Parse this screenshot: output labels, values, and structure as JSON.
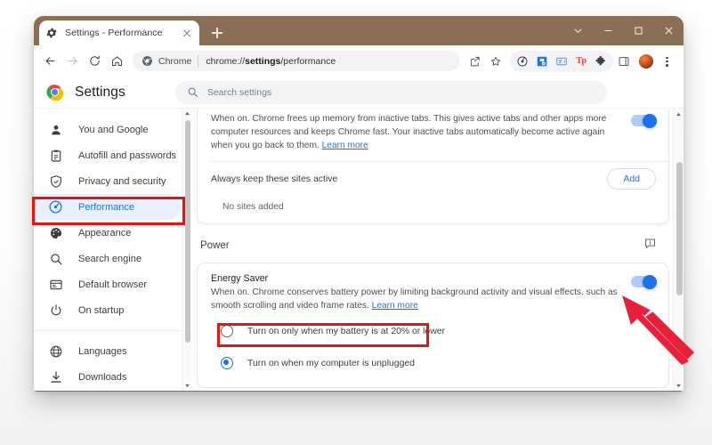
{
  "window": {
    "frame_color": "#8a6f54",
    "controls": [
      {
        "name": "tab-search-chevron",
        "icon": "chevron-down-icon"
      },
      {
        "name": "minimize",
        "icon": "minimize-icon"
      },
      {
        "name": "maximize",
        "icon": "maximize-icon"
      },
      {
        "name": "close",
        "icon": "close-icon"
      }
    ]
  },
  "tab": {
    "title": "Settings - Performance",
    "favicon": "gear-icon",
    "close_icon": "close-icon",
    "new_tab_icon": "plus-icon"
  },
  "toolbar": {
    "back_icon": "arrow-left-icon",
    "forward_icon": "arrow-right-icon",
    "reload_icon": "reload-icon",
    "home_icon": "home-icon",
    "omnibox": {
      "chip_icon": "chrome-circle-icon",
      "chip_label": "Chrome",
      "url_prefix": "chrome://",
      "url_bold": "settings",
      "url_suffix": "/performance"
    },
    "share_icon": "share-icon",
    "bookmark_icon": "star-icon",
    "extensions": [
      {
        "name": "extension-chrome-loop",
        "label": ""
      },
      {
        "name": "extension-blue-save",
        "label": ""
      },
      {
        "name": "extension-reader",
        "label": ""
      },
      {
        "name": "extension-tp",
        "label": "Tp",
        "color": "#ea4335"
      },
      {
        "name": "extensions-puzzle",
        "label": ""
      }
    ],
    "side_panel_icon": "side-panel-icon",
    "avatar": "profile-avatar",
    "menu_icon": "kebab-menu-icon"
  },
  "settings_header": {
    "logo": "chrome-logo",
    "title": "Settings",
    "search": {
      "icon": "search-icon",
      "placeholder": "Search settings",
      "value": ""
    }
  },
  "sidebar": {
    "items": [
      {
        "label": "You and Google",
        "icon": "person-icon",
        "active": false
      },
      {
        "label": "Autofill and passwords",
        "icon": "clipboard-icon",
        "active": false
      },
      {
        "label": "Privacy and security",
        "icon": "shield-icon",
        "active": false
      },
      {
        "label": "Performance",
        "icon": "speedometer-icon",
        "active": true
      },
      {
        "label": "Appearance",
        "icon": "palette-icon",
        "active": false
      },
      {
        "label": "Search engine",
        "icon": "search-icon",
        "active": false
      },
      {
        "label": "Default browser",
        "icon": "browser-window-icon",
        "active": false
      },
      {
        "label": "On startup",
        "icon": "power-icon",
        "active": false
      }
    ],
    "items_after_divider": [
      {
        "label": "Languages",
        "icon": "globe-icon",
        "active": false
      },
      {
        "label": "Downloads",
        "icon": "download-icon",
        "active": false
      }
    ],
    "active_color": "#1a73e8",
    "active_bg": "#e8f0fe"
  },
  "main": {
    "memory_saver": {
      "description": "When on. Chrome frees up memory from inactive tabs. This gives active tabs and other apps more computer resources and keeps Chrome fast. Your inactive tabs automatically become active again when you go back to them.",
      "learn_more": "Learn more",
      "toggle_on": true,
      "sites_label": "Always keep these sites active",
      "add_button": "Add",
      "no_sites": "No sites added"
    },
    "power": {
      "section_title": "Power",
      "feedback_icon": "feedback-icon",
      "energy_saver": {
        "name": "Energy Saver",
        "description": "When on. Chrome conserves battery power by limiting background activity and visual effects. such as smooth scrolling and video frame rates.",
        "learn_more": "Learn more",
        "toggle_on": true,
        "options": [
          {
            "label": "Turn on only when my battery is at 20% or lower",
            "selected": false
          },
          {
            "label": "Turn on when my computer is unplugged",
            "selected": true
          }
        ]
      }
    },
    "scrollbar": {
      "up_icon": "caret-up-icon",
      "down_icon": "caret-down-icon"
    }
  },
  "annotations": {
    "highlight_color": "#ee1111",
    "boxes": [
      {
        "name": "performance-sidebar-highlight"
      },
      {
        "name": "battery-radio-highlight"
      }
    ],
    "arrow": {
      "name": "energy-saver-toggle-arrow",
      "color": "#e8203a"
    }
  }
}
